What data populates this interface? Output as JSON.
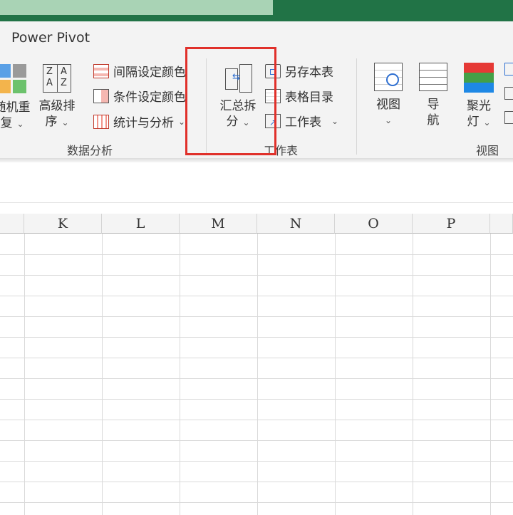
{
  "ribbon": {
    "tab": "Power Pivot",
    "shuffle_label": [
      "随机重",
      "复"
    ],
    "sort_label": [
      "高级排",
      "序"
    ],
    "data_rows": [
      "间隔设定颜色",
      "条件设定颜色",
      "统计与分析"
    ],
    "data_group": "数据分析",
    "summary_label": [
      "汇总拆",
      "分"
    ],
    "sheet_rows": [
      "另存本表",
      "表格目录",
      "工作表"
    ],
    "sheet_group": "工作表",
    "view_label": "视图",
    "nav_label": [
      "导",
      "航"
    ],
    "spot_label": [
      "聚光",
      "灯"
    ],
    "view_group": "视图"
  },
  "sheet": {
    "columns": [
      "K",
      "L",
      "M",
      "N",
      "O",
      "P"
    ]
  },
  "colors": {
    "title_green": "#217346",
    "highlight_red": "#e0302a"
  }
}
